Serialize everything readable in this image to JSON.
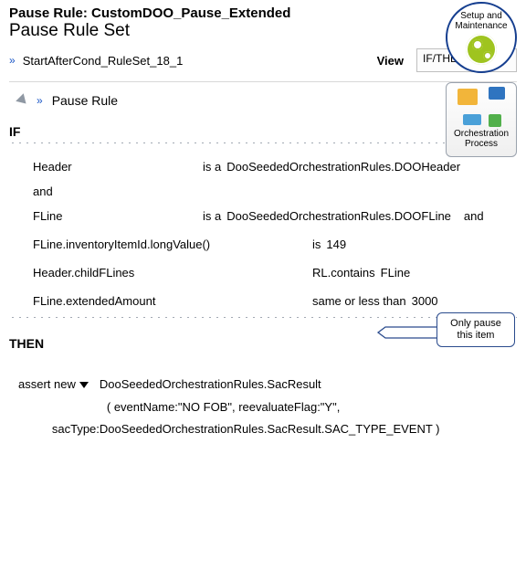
{
  "title": "Pause Rule: CustomDOO_Pause_Extended",
  "subtitle": "Pause Rule Set",
  "ruleset_name": "StartAfterCond_RuleSet_18_1",
  "view_label": "View",
  "view_selected": "IF/THEN Rules",
  "rule_name": "Pause Rule",
  "if_kw": "IF",
  "then_kw": "THEN",
  "and_kw": "and",
  "conditions": {
    "c1_left": "Header",
    "c1_op": "is a",
    "c1_right": "DooSeededOrchestrationRules.DOOHeader",
    "c2_left": "FLine",
    "c2_op": "is a",
    "c2_right": "DooSeededOrchestrationRules.DOOFLine",
    "c2_tail": "and",
    "c3_left": "FLine.inventoryItemId.longValue()",
    "c3_op": "is",
    "c3_right": "149",
    "c4_left": "Header.childFLines",
    "c4_op": "RL.contains",
    "c4_right": "FLine",
    "c5_left": "FLine.extendedAmount",
    "c5_op": "same or less than",
    "c5_right": "3000"
  },
  "action": {
    "assert_label": "assert new",
    "line1": "DooSeededOrchestrationRules.SacResult",
    "line2": "( eventName:\"NO FOB\", reevaluateFlag:\"Y\",",
    "line3": "sacType:DooSeededOrchestrationRules.SacResult.SAC_TYPE_EVENT )"
  },
  "badges": {
    "setup_line1": "Setup and",
    "setup_line2": "Maintenance",
    "orch_line1": "Orchestration",
    "orch_line2": "Process"
  },
  "callout": {
    "line1": "Only pause",
    "line2": "this item"
  }
}
